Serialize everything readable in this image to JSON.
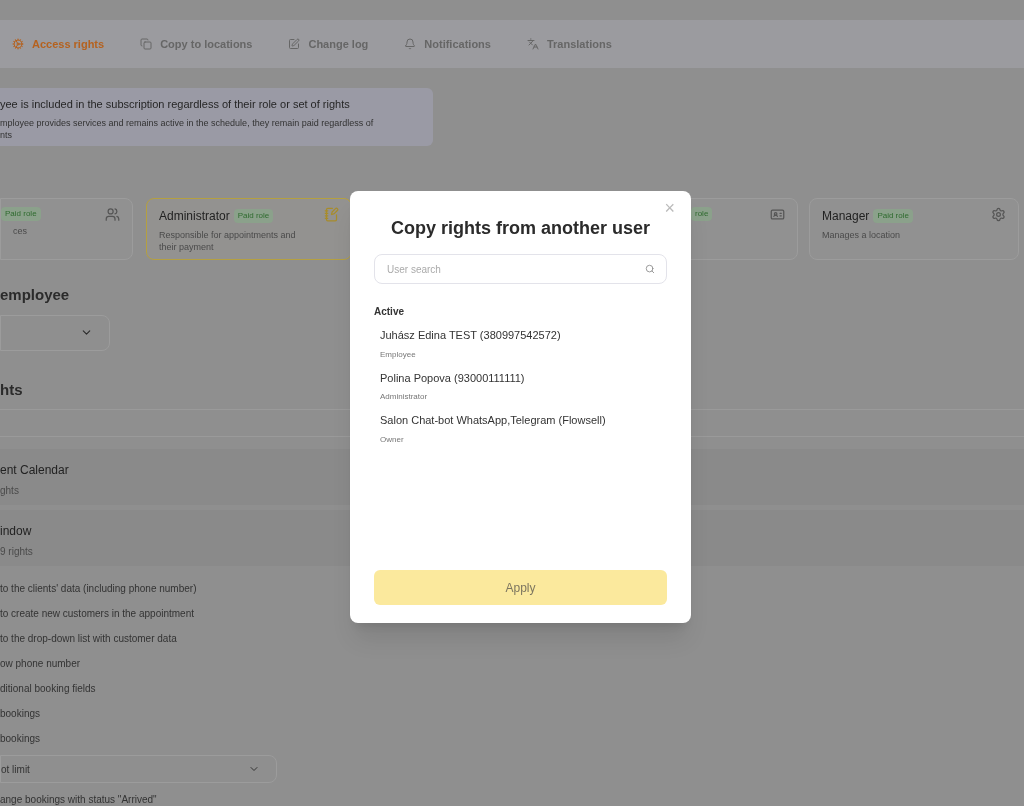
{
  "tabs": [
    {
      "label": "Access rights",
      "selected": true
    },
    {
      "label": "Copy to locations",
      "selected": false
    },
    {
      "label": "Change log",
      "selected": false
    },
    {
      "label": "Notifications",
      "selected": false
    },
    {
      "label": "Translations",
      "selected": false
    }
  ],
  "notice": {
    "title": "yee is included in the subscription regardless of their role or set of rights",
    "text": "mployee provides services and remains active in the schedule, they remain paid regardless of",
    "text_2": "nts"
  },
  "roles": [
    {
      "badge": "Paid role",
      "description": "ces",
      "selected": false
    },
    {
      "name": "Administrator",
      "badge": "Paid role",
      "description": "Responsible for appointments and their payment",
      "selected": true
    },
    {
      "badge": "role",
      "selected": false
    },
    {
      "name": "Manager",
      "badge": "Paid role",
      "description": "Manages a location",
      "selected": false
    }
  ],
  "employee_heading": "employee",
  "rights_heading": "hts",
  "sections": [
    {
      "title": "ent Calendar",
      "count": "ghts"
    },
    {
      "title": "indow",
      "count": "9 rights"
    }
  ],
  "rights": [
    {
      "kind": "text",
      "label": "to the clients' data (including phone number)"
    },
    {
      "kind": "text",
      "label": "to create new customers in the appointment"
    },
    {
      "kind": "text",
      "label": "to the drop-down list with customer data"
    },
    {
      "kind": "text",
      "label": "ow phone number"
    },
    {
      "kind": "text",
      "label": "ditional booking fields"
    },
    {
      "kind": "text",
      "label": "bookings"
    },
    {
      "kind": "text",
      "label": "bookings"
    },
    {
      "kind": "select",
      "label": "ot limit"
    },
    {
      "kind": "text",
      "label": "ange bookings with status \"Arrived\""
    }
  ],
  "modal": {
    "title": "Copy rights from another user",
    "close": "×",
    "search": {
      "placeholder": "User search"
    },
    "group": "Active",
    "users": [
      {
        "name": "Juhász Edina TEST (380997542572)",
        "role": "Employee"
      },
      {
        "name": "Polina Popova (93000111111)",
        "role": "Administrator"
      },
      {
        "name": "Salon Chat-bot WhatsApp,Telegram (Flowsell)",
        "role": "Owner"
      }
    ],
    "apply": {
      "label": "Apply",
      "disabled": true
    }
  }
}
